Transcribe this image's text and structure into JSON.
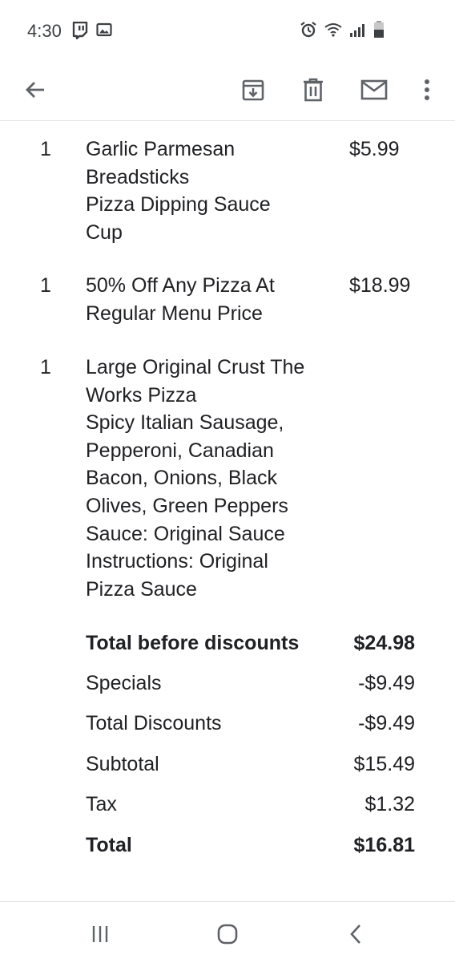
{
  "status_bar": {
    "time": "4:30"
  },
  "order_items": [
    {
      "qty": "1",
      "lines": [
        "Garlic Parmesan",
        "Breadsticks",
        "Pizza Dipping Sauce",
        "Cup"
      ],
      "price": "$5.99"
    },
    {
      "qty": "1",
      "lines": [
        "50% Off Any Pizza At",
        "Regular Menu Price"
      ],
      "price": "$18.99"
    },
    {
      "qty": "1",
      "lines": [
        "Large Original Crust The",
        "Works Pizza",
        "Spicy Italian Sausage,",
        "Pepperoni, Canadian",
        "Bacon, Onions, Black",
        "Olives, Green Peppers",
        "Sauce: Original Sauce",
        "Instructions: Original",
        "Pizza Sauce"
      ],
      "price": ""
    }
  ],
  "summary": [
    {
      "label": "Total before discounts",
      "amount": "$24.98",
      "bold": true
    },
    {
      "label": "Specials",
      "amount": "-$9.49",
      "bold": false
    },
    {
      "label": "Total Discounts",
      "amount": "-$9.49",
      "bold": false
    },
    {
      "label": "Subtotal",
      "amount": "$15.49",
      "bold": false
    },
    {
      "label": "Tax",
      "amount": "$1.32",
      "bold": false
    },
    {
      "label": "Total",
      "amount": "$16.81",
      "bold": true
    }
  ],
  "icons": {
    "back": "arrow-back-icon",
    "archive": "archive-icon",
    "delete": "trash-icon",
    "mark_unread": "mail-icon",
    "more": "more-vert-icon"
  },
  "colors": {
    "text": "#202124",
    "icon": "#5f6368"
  }
}
